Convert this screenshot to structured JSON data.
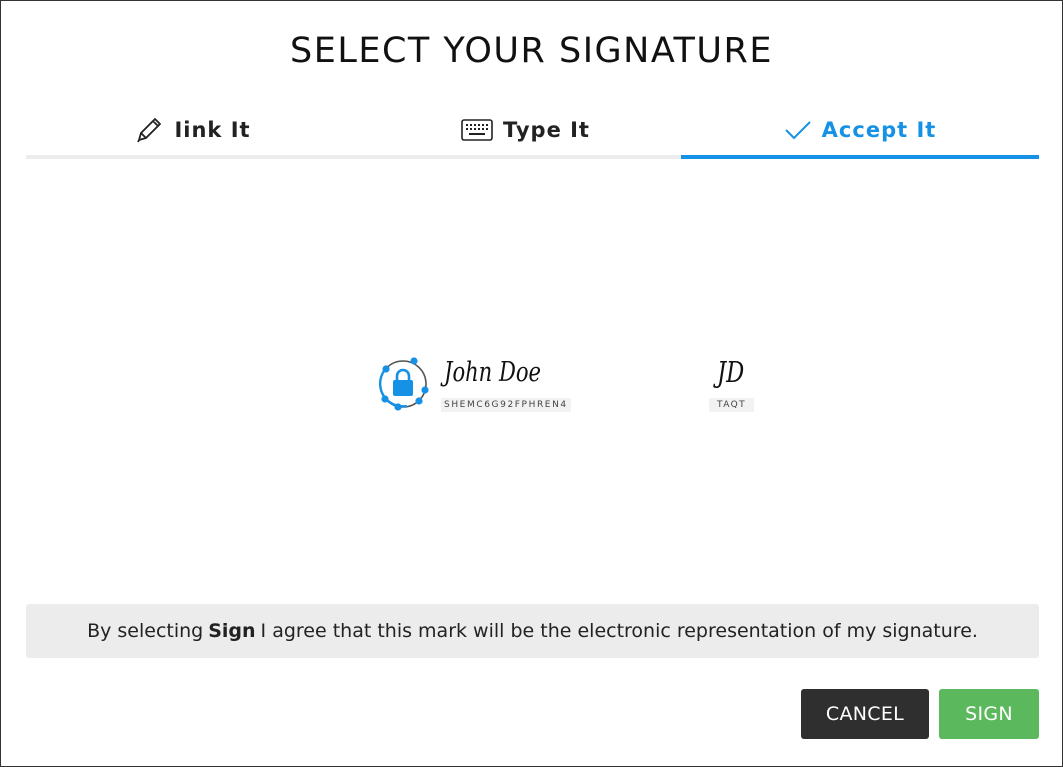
{
  "dialog": {
    "title": "SELECT YOUR SIGNATURE"
  },
  "tabs": [
    {
      "label": "Iink It",
      "icon": "pencil-icon",
      "active": false
    },
    {
      "label": "Type It",
      "icon": "keyboard-icon",
      "active": false
    },
    {
      "label": "Accept It",
      "icon": "checkmark-icon",
      "active": true
    }
  ],
  "signature": {
    "name": "John Doe",
    "code": "SHEMC6G92FPHREN4",
    "icon": "secure-lock-icon"
  },
  "initials": {
    "text": "JD",
    "code": "TAQT"
  },
  "consent": {
    "prefix": "By selecting",
    "keyword": "Sign",
    "suffix": "I agree that this mark will be the electronic representation of my signature."
  },
  "buttons": {
    "cancel_label": "CANCEL",
    "sign_label": "SIGN"
  },
  "colors": {
    "accent": "#1591e5",
    "sign_button": "#5cb85c",
    "cancel_button": "#2f2f2f",
    "consent_background": "#ececec"
  }
}
